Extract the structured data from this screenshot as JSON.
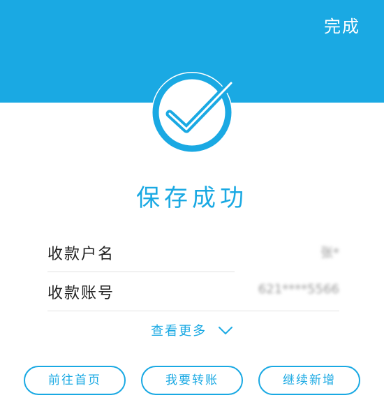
{
  "header": {
    "done_label": "完成",
    "bg_color": "#1aa9e3"
  },
  "status": {
    "icon": "checkmark-circle-icon",
    "title": "保存成功"
  },
  "fields": [
    {
      "label": "收款户名",
      "value": "张*"
    },
    {
      "label": "收款账号",
      "value": "621****5566"
    }
  ],
  "more": {
    "label": "查看更多",
    "icon": "chevron-down-icon"
  },
  "actions": [
    {
      "label": "前往首页"
    },
    {
      "label": "我要转账"
    },
    {
      "label": "继续新增"
    }
  ],
  "colors": {
    "accent": "#1aa9e3",
    "text": "#222222",
    "divider": "#e2e2e2"
  }
}
